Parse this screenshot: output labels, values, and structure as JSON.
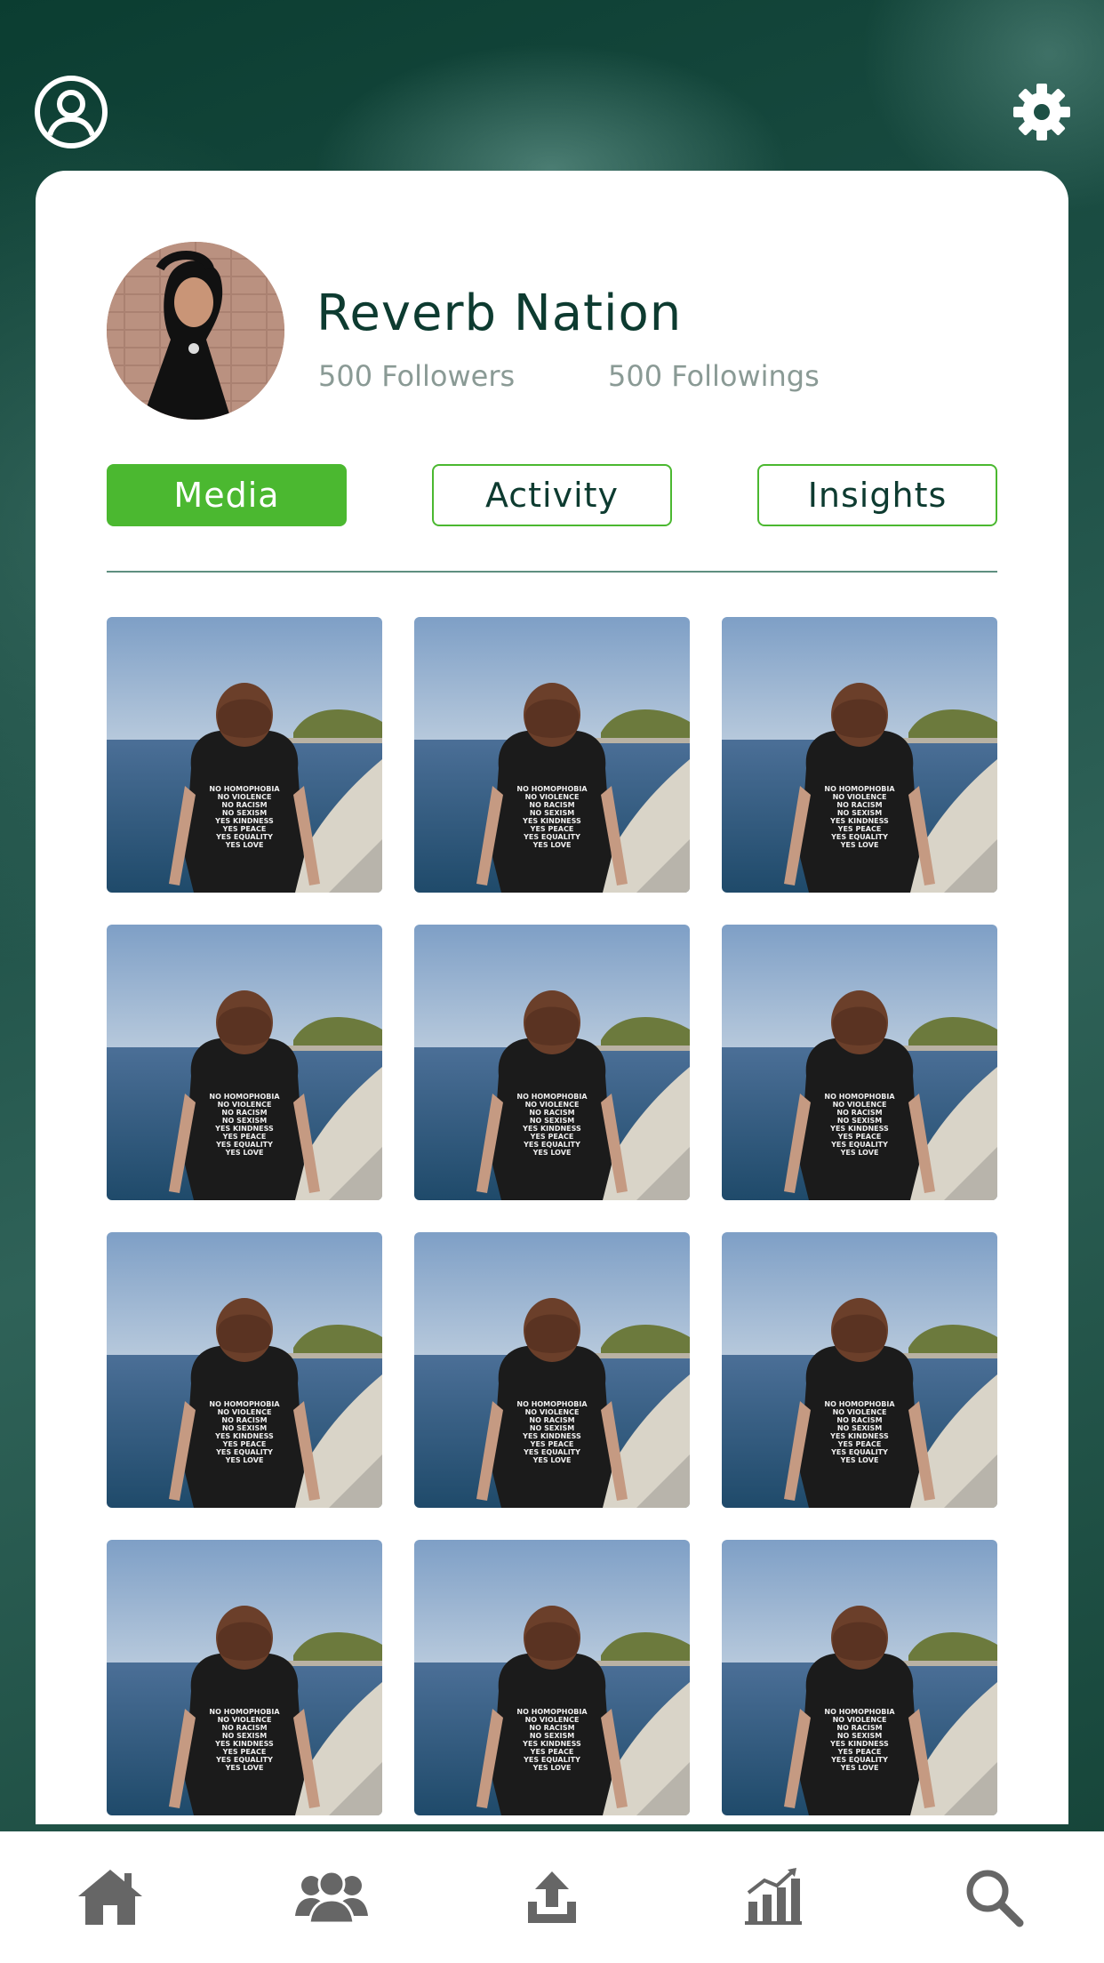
{
  "header": {
    "profile_icon": "user-circle-icon",
    "settings_icon": "gear-icon"
  },
  "profile": {
    "name": "Reverb Nation",
    "followers": "500 Followers",
    "followings": "500 Followings"
  },
  "tabs": [
    {
      "label": "Media",
      "active": true
    },
    {
      "label": "Activity",
      "active": false
    },
    {
      "label": "Insights",
      "active": false
    }
  ],
  "media": {
    "count": 12,
    "shirt_text": [
      "NO HOMOPHOBIA",
      "NO VIOLENCE",
      "NO RACISM",
      "NO SEXISM",
      "YES KINDNESS",
      "YES PEACE",
      "YES EQUALITY",
      "YES LOVE"
    ]
  },
  "bottom_nav": [
    {
      "icon": "home-icon"
    },
    {
      "icon": "users-icon"
    },
    {
      "icon": "upload-icon"
    },
    {
      "icon": "chart-icon"
    },
    {
      "icon": "search-icon"
    }
  ],
  "colors": {
    "accent_green": "#4bb830",
    "dark_green": "#0d3b30",
    "muted_text": "#8a9a95"
  }
}
